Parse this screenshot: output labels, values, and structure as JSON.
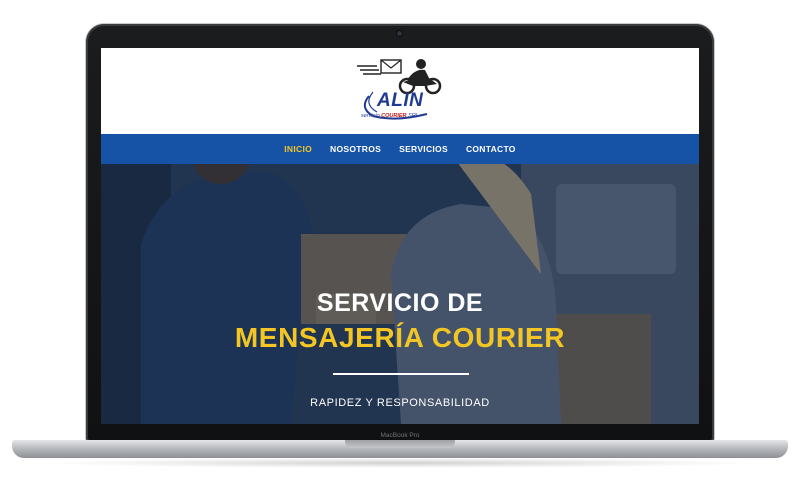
{
  "site": {
    "logo": {
      "name": "ALIN",
      "tagline_prefix": "servicio ",
      "tagline_highlight": "COURIER",
      "tagline_suffix": " SRL"
    },
    "nav": {
      "items": [
        {
          "label": "INICIO",
          "active": true
        },
        {
          "label": "NOSOTROS",
          "active": false
        },
        {
          "label": "SERVICIOS",
          "active": false
        },
        {
          "label": "CONTACTO",
          "active": false
        }
      ]
    },
    "hero": {
      "title_line1": "SERVICIO DE",
      "title_line2": "MENSAJERÍA COURIER",
      "subtitle": "RAPIDEZ Y RESPONSABILIDAD"
    }
  },
  "device": {
    "label": "MacBook Pro"
  },
  "colors": {
    "nav_background": "#1653a7",
    "accent_yellow": "#f3c623",
    "logo_blue": "#1f3a93",
    "logo_red": "#c21b1b"
  }
}
